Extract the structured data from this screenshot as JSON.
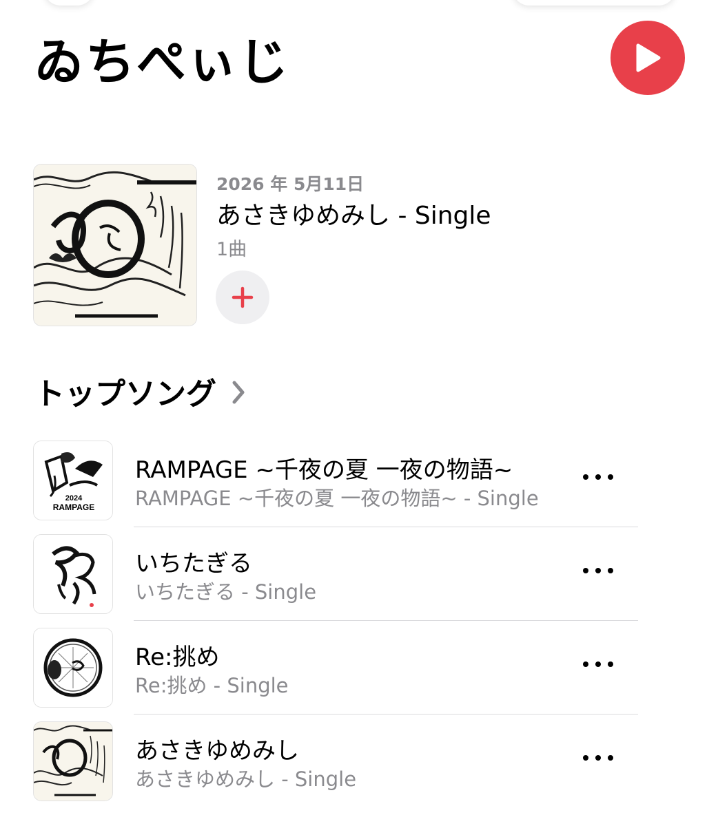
{
  "artist": {
    "name": "ゐちぺぃじ"
  },
  "colors": {
    "accent": "#e8404a",
    "secondary_text": "#8a8a8e",
    "add_button_bg": "#efeff1",
    "divider": "#d9d9dc"
  },
  "latest_release": {
    "date": "2026 年 5月11日",
    "title": "あさきゆめみし - Single",
    "track_count": "1曲",
    "add_icon": "plus-icon"
  },
  "top_songs": {
    "header": "トップソング",
    "header_icon": "chevron-right-icon",
    "items": [
      {
        "title": "RAMPAGE ~千夜の夏 一夜の物語~",
        "subtitle": "RAMPAGE ~千夜の夏 一夜の物語~ - Single",
        "more_icon": "ellipsis-icon"
      },
      {
        "title": "いちたぎる",
        "subtitle": "いちたぎる - Single",
        "more_icon": "ellipsis-icon"
      },
      {
        "title": "Re:挑め",
        "subtitle": "Re:挑め - Single",
        "more_icon": "ellipsis-icon"
      },
      {
        "title": "あさきゆめみし",
        "subtitle": "あさきゆめみし - Single",
        "more_icon": "ellipsis-icon"
      }
    ]
  },
  "artwork_text": {
    "rampage_year": "2024",
    "rampage_label": "RAMPAGE"
  }
}
